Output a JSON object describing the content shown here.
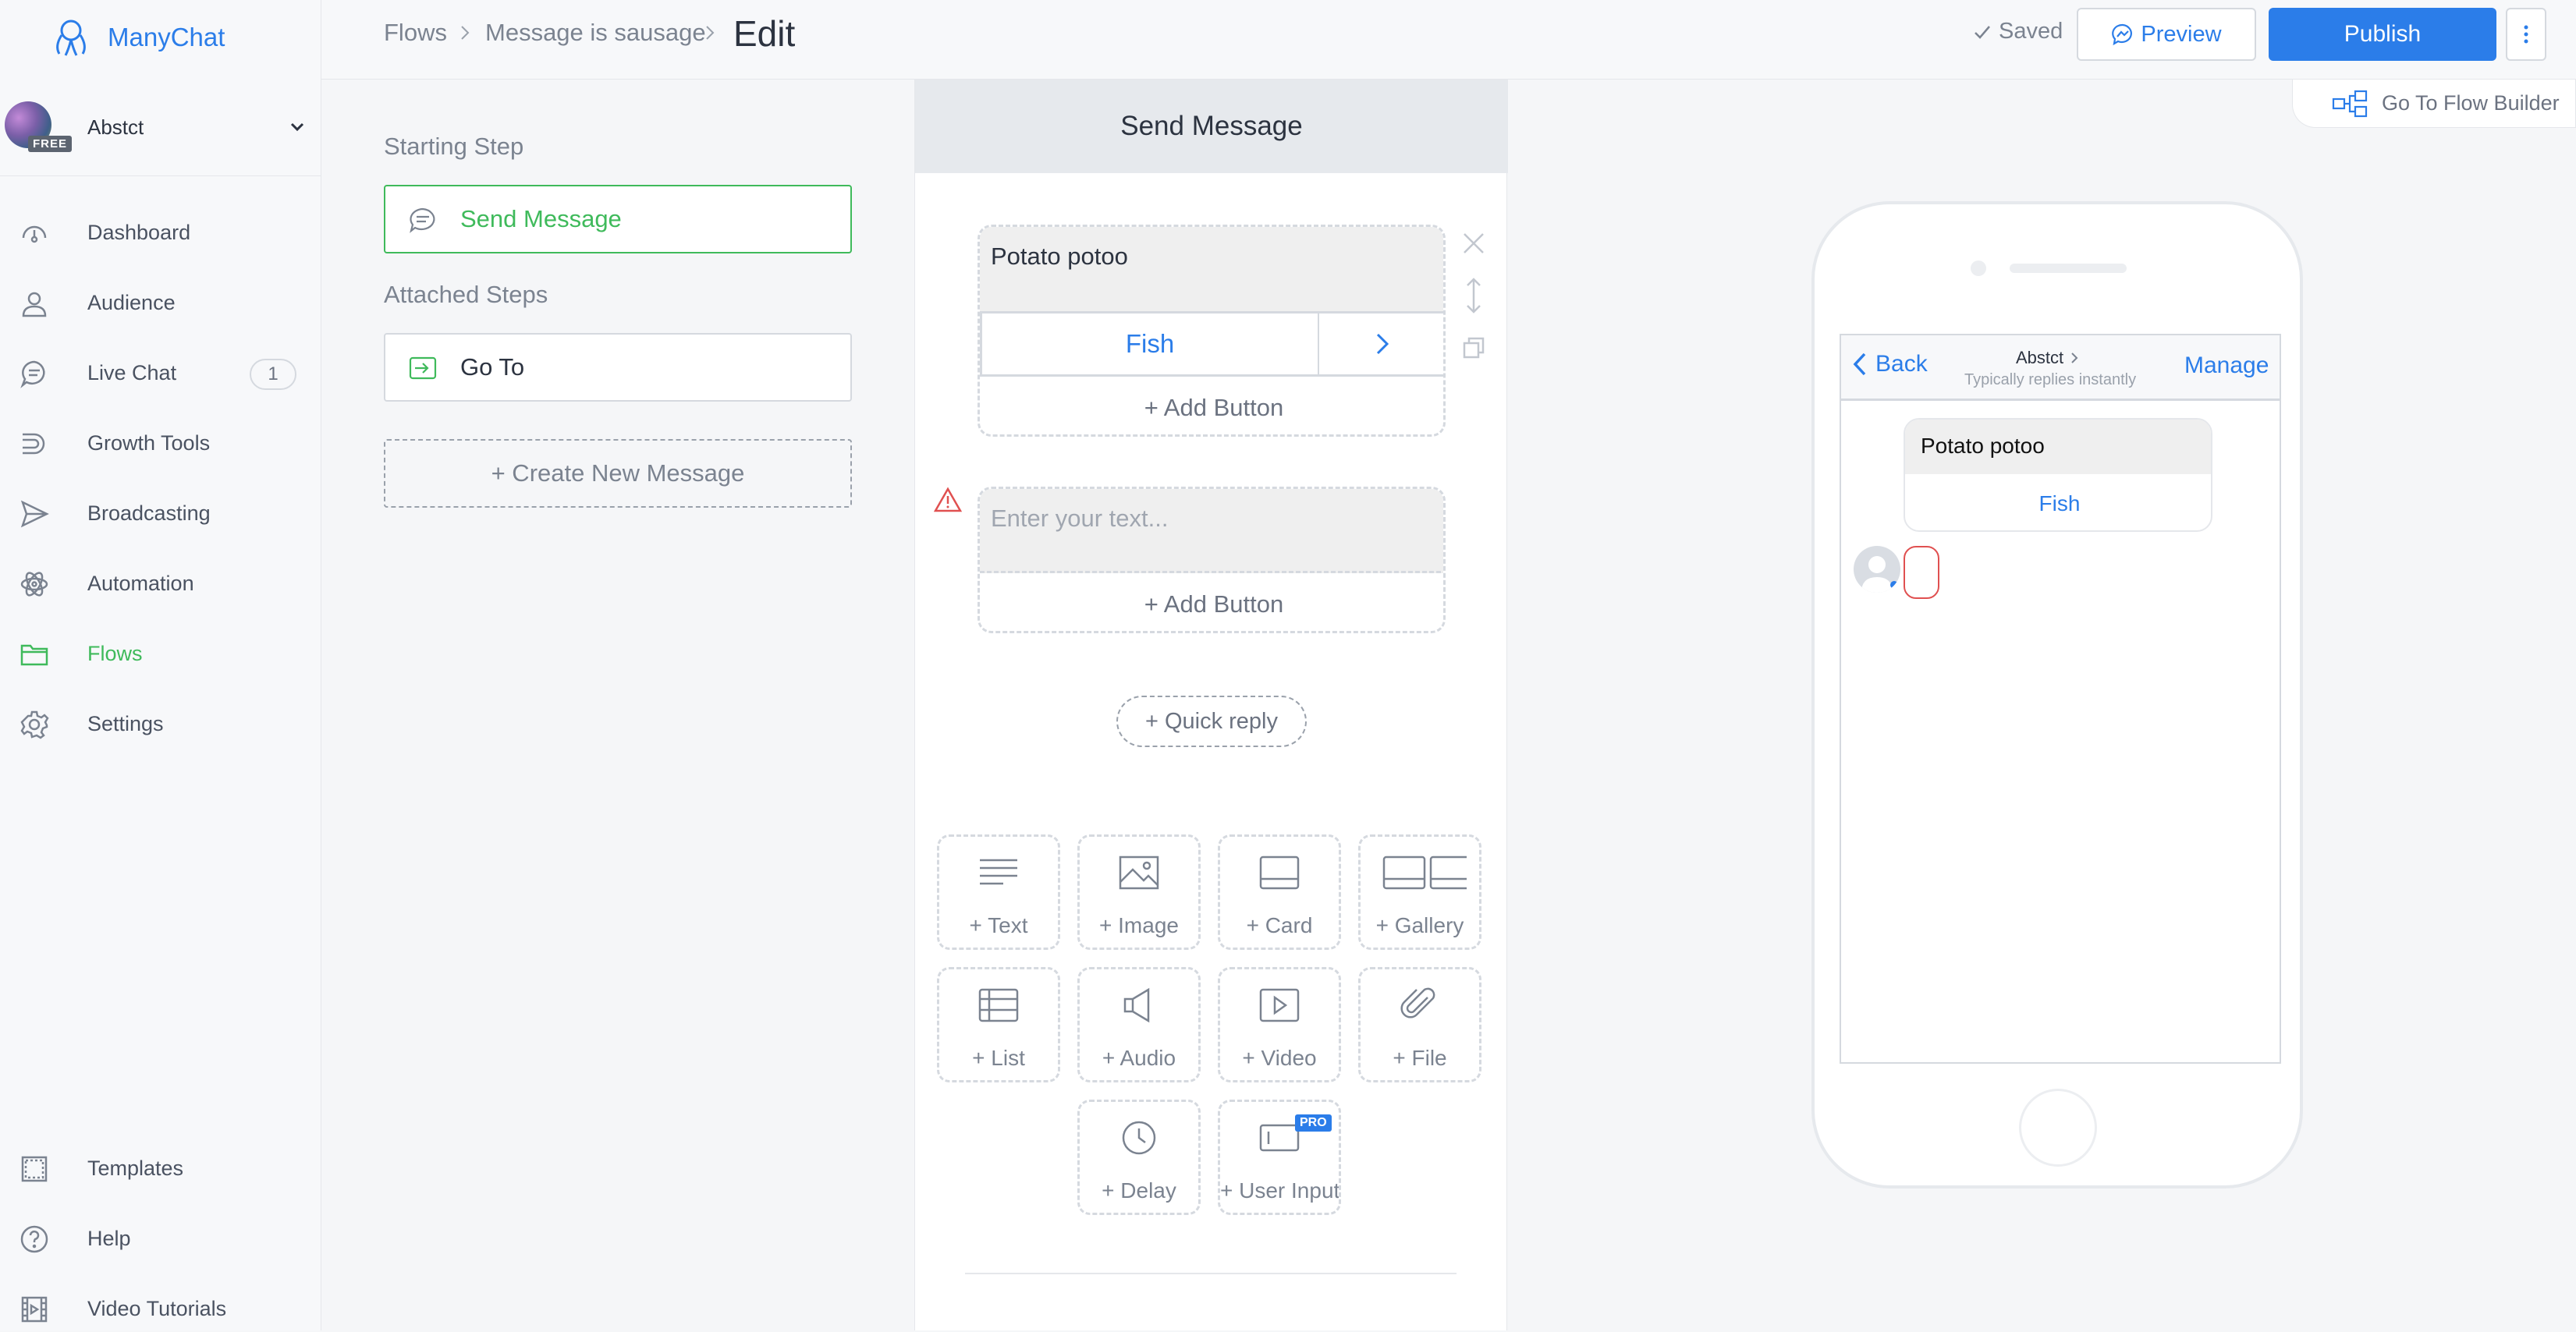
{
  "app": {
    "name": "ManyChat",
    "brand_color": "#2b7de9",
    "active_color": "#3fba5b"
  },
  "account": {
    "name": "Abstct",
    "plan_badge": "FREE"
  },
  "sidebar": {
    "items": [
      {
        "label": "Dashboard",
        "icon": "dashboard-icon"
      },
      {
        "label": "Audience",
        "icon": "user-icon"
      },
      {
        "label": "Live Chat",
        "icon": "chat-icon",
        "badge": "1"
      },
      {
        "label": "Growth Tools",
        "icon": "magnet-icon"
      },
      {
        "label": "Broadcasting",
        "icon": "send-icon"
      },
      {
        "label": "Automation",
        "icon": "atom-icon"
      },
      {
        "label": "Flows",
        "icon": "folder-icon",
        "active": true
      },
      {
        "label": "Settings",
        "icon": "gear-icon"
      }
    ],
    "bottom_items": [
      {
        "label": "Templates",
        "icon": "template-icon"
      },
      {
        "label": "Help",
        "icon": "help-icon"
      },
      {
        "label": "Video Tutorials",
        "icon": "film-icon"
      }
    ]
  },
  "topbar": {
    "breadcrumbs": [
      "Flows",
      "Message is sausage"
    ],
    "current": "Edit",
    "saved_label": "Saved",
    "preview_label": "Preview",
    "publish_label": "Publish",
    "flow_builder_label": "Go To Flow Builder"
  },
  "steps": {
    "starting_title": "Starting Step",
    "starting_step": "Send Message",
    "attached_title": "Attached Steps",
    "attached_step": "Go To",
    "create_label": "+ Create New Message"
  },
  "editor": {
    "title": "Send Message",
    "message1_text": "Potato potoo",
    "message1_button": "Fish",
    "add_button_label": "+ Add Button",
    "message2_placeholder": "Enter your text...",
    "quick_reply_label": "+ Quick reply",
    "tiles": [
      {
        "label": "+ Text",
        "icon": "text-icon"
      },
      {
        "label": "+ Image",
        "icon": "image-icon"
      },
      {
        "label": "+ Card",
        "icon": "card-icon"
      },
      {
        "label": "+ Gallery",
        "icon": "gallery-icon"
      },
      {
        "label": "+ List",
        "icon": "list-icon"
      },
      {
        "label": "+ Audio",
        "icon": "audio-icon"
      },
      {
        "label": "+ Video",
        "icon": "video-icon"
      },
      {
        "label": "+ File",
        "icon": "paperclip-icon"
      },
      {
        "label": "+ Delay",
        "icon": "clock-icon"
      },
      {
        "label": "+ User Input",
        "icon": "input-icon",
        "badge": "PRO"
      }
    ]
  },
  "preview": {
    "back_label": "Back",
    "page_name": "Abstct",
    "status": "Typically replies instantly",
    "manage_label": "Manage",
    "bubble_text": "Potato potoo",
    "bubble_button": "Fish"
  }
}
